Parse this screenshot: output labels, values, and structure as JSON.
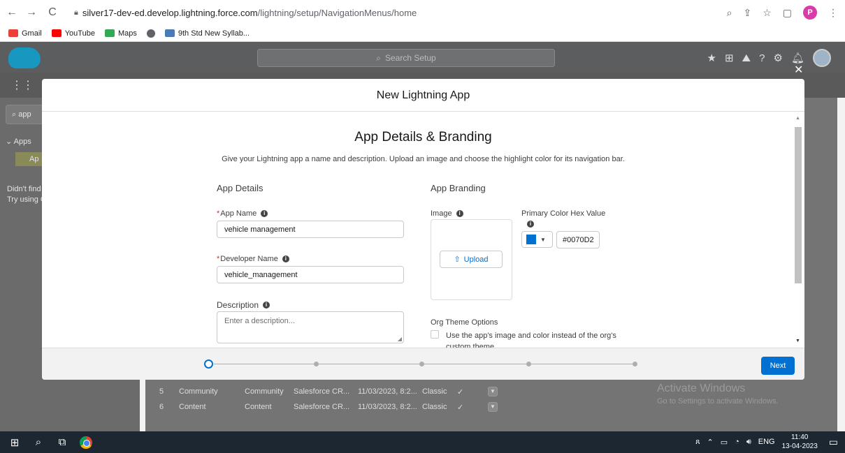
{
  "browser": {
    "url_host": "silver17-dev-ed.develop.lightning.force.com",
    "url_path": "/lightning/setup/NavigationMenus/home",
    "profile_initial": "P",
    "bookmarks": [
      {
        "label": "Gmail",
        "icon": "gmail-icon",
        "color": "#ea4335"
      },
      {
        "label": "YouTube",
        "icon": "youtube-icon",
        "color": "#ff0000"
      },
      {
        "label": "Maps",
        "icon": "maps-icon",
        "color": "#34a853"
      },
      {
        "label": "",
        "icon": "globe-icon",
        "color": "#5f6368"
      },
      {
        "label": "9th Std New Syllab...",
        "icon": "bookmark-site-icon",
        "color": "#4a7bb7"
      }
    ]
  },
  "salesforce": {
    "search_placeholder": "Search Setup",
    "sidebar_search": "app",
    "sidebar_group": "Apps",
    "sidebar_item": "Ap",
    "sidebar_hint_1": "Didn't find",
    "sidebar_hint_2": "Try using G",
    "table_rows": [
      {
        "num": "5",
        "label": "Community",
        "dev": "Community",
        "desc": "Salesforce CR...",
        "date": "11/03/2023, 8:2...",
        "ui": "Classic",
        "check": "✓"
      },
      {
        "num": "6",
        "label": "Content",
        "dev": "Content",
        "desc": "Salesforce CR...",
        "date": "11/03/2023, 8:2...",
        "ui": "Classic",
        "check": "✓"
      }
    ]
  },
  "watermark": {
    "line1": "Activate Windows",
    "line2": "Go to Settings to activate Windows."
  },
  "modal": {
    "title": "New Lightning App",
    "section_title": "App Details & Branding",
    "section_subtitle": "Give your Lightning app a name and description. Upload an image and choose the highlight color for its navigation bar.",
    "details_title": "App Details",
    "branding_title": "App Branding",
    "app_name_label": "App Name",
    "app_name_value": "vehicle management",
    "dev_name_label": "Developer Name",
    "dev_name_value": "vehicle_management",
    "description_label": "Description",
    "description_placeholder": "Enter a description...",
    "image_label": "Image",
    "upload_label": "Upload",
    "color_label": "Primary Color Hex Value",
    "color_value": "#0070D2",
    "theme_title": "Org Theme Options",
    "theme_checkbox_text": "Use the app's image and color instead of the org's custom theme",
    "next_label": "Next",
    "required_mark": "*",
    "accent_color": "#0070d2"
  },
  "taskbar": {
    "language": "ENG",
    "time": "11:40",
    "date": "13-04-2023"
  }
}
